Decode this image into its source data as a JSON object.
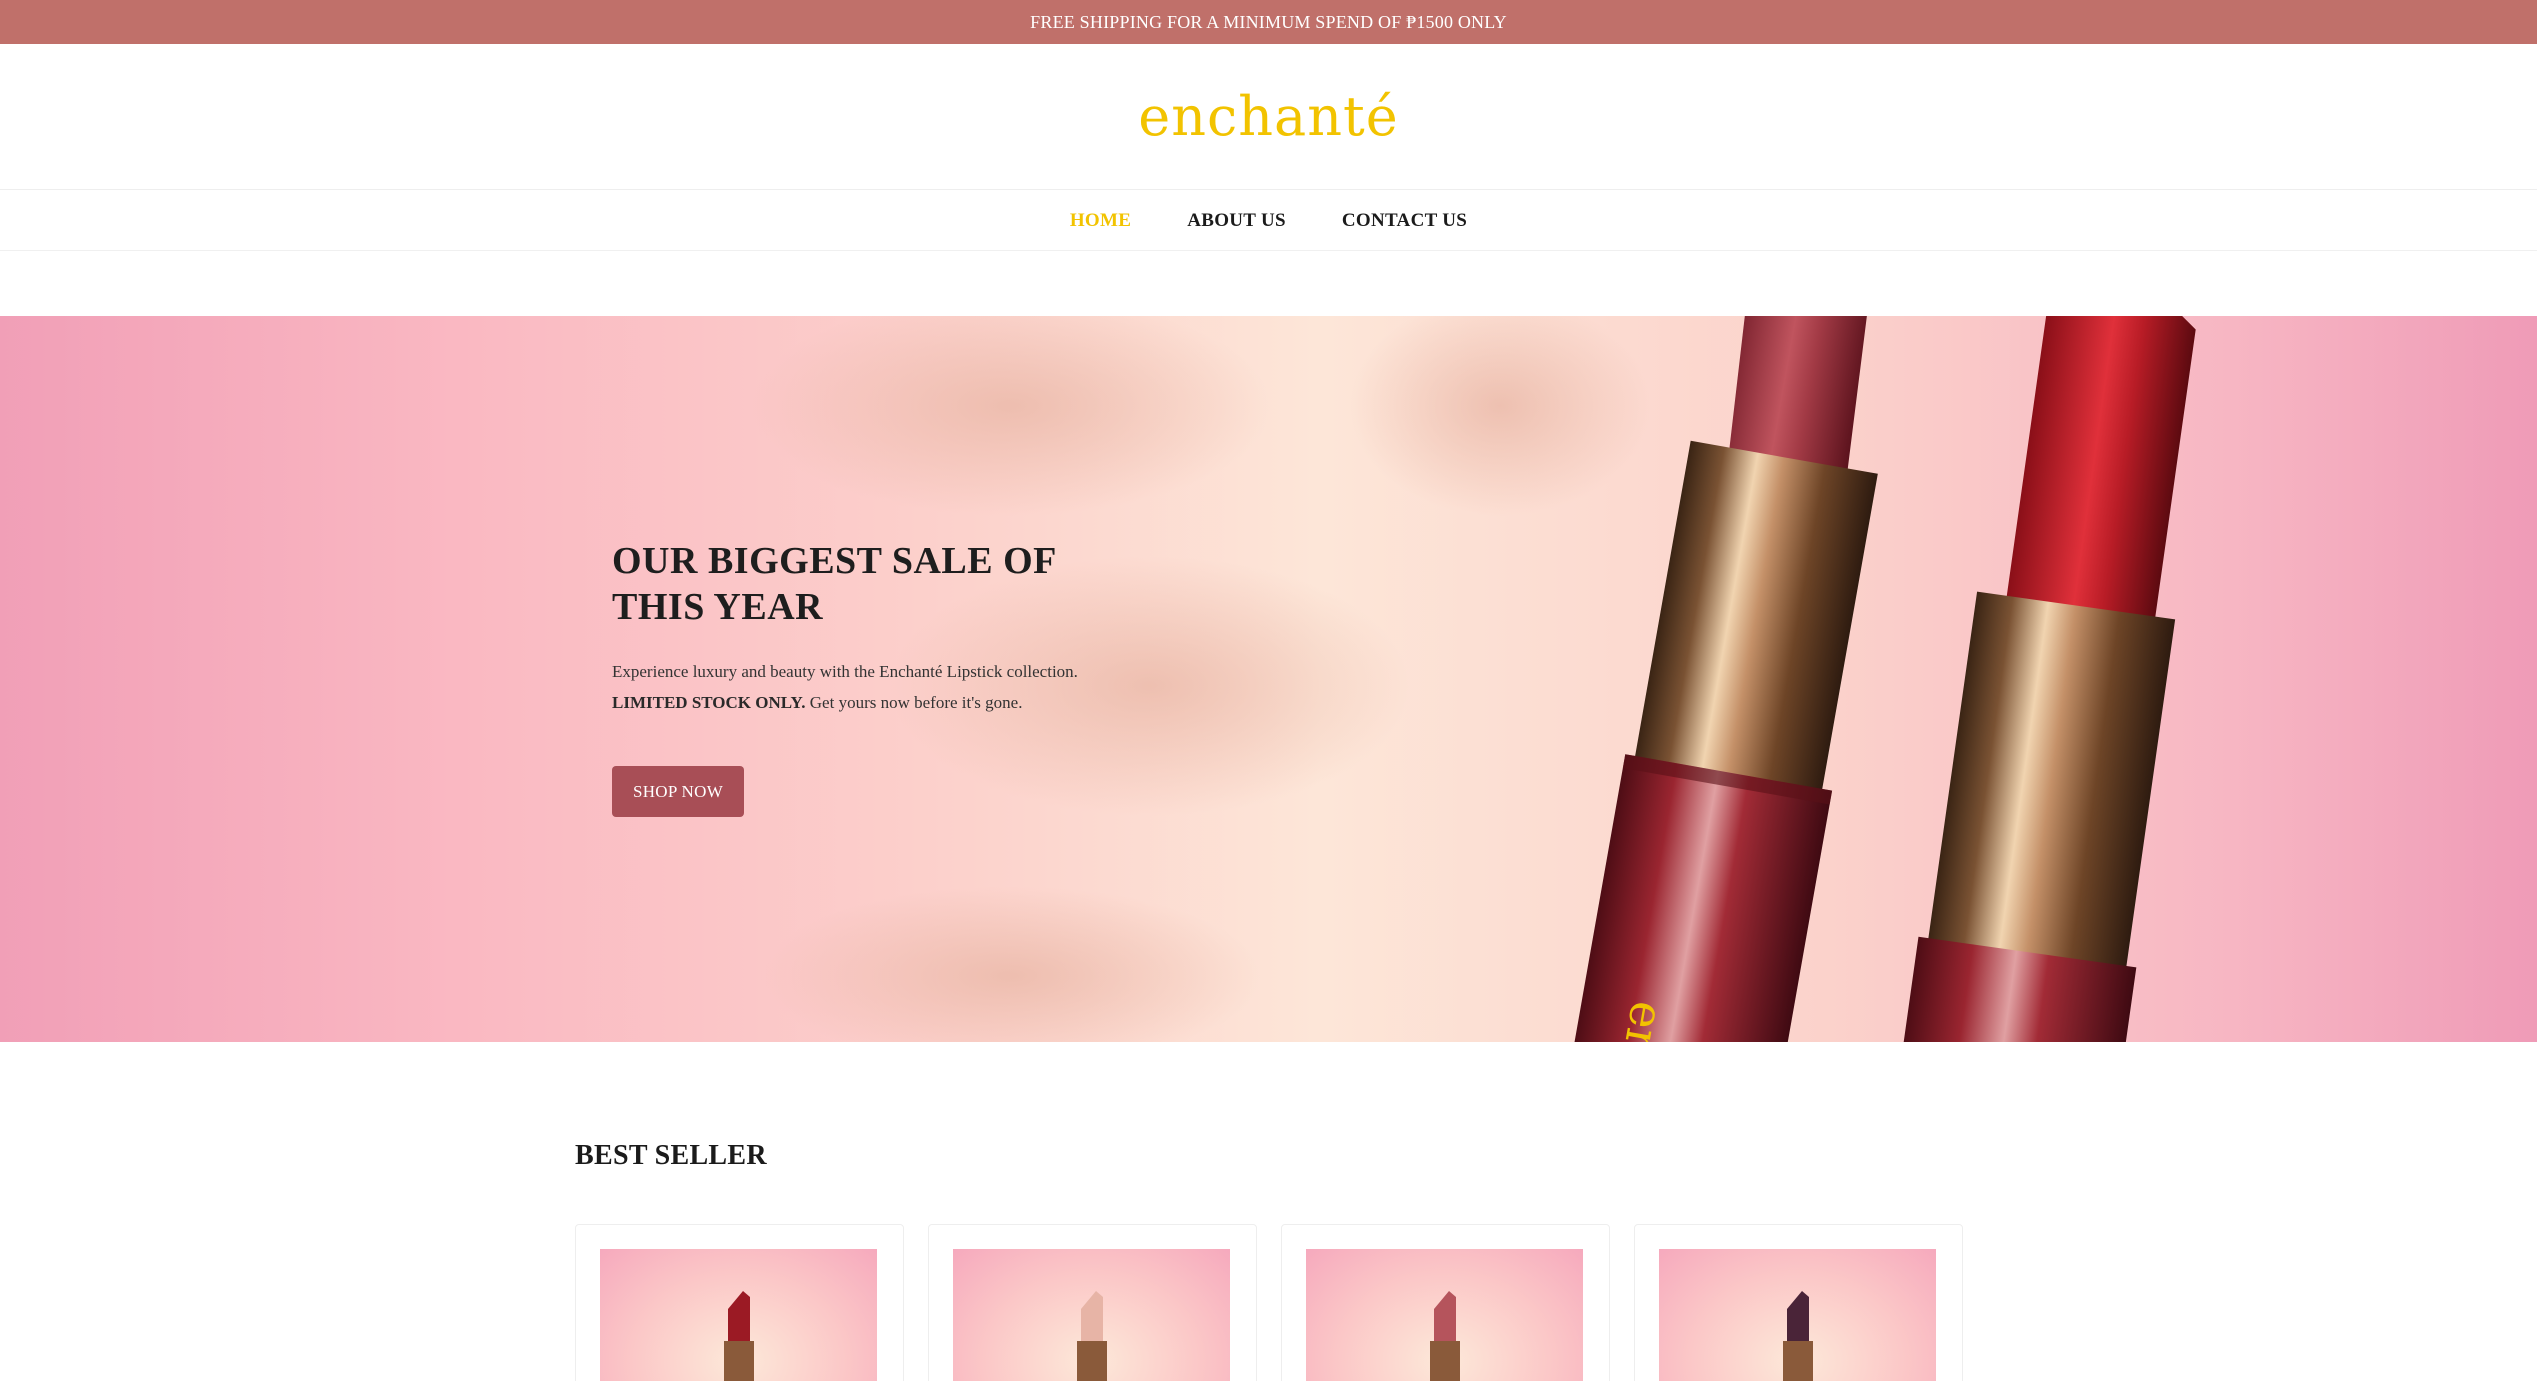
{
  "announcement": "FREE SHIPPING FOR A MINIMUM SPEND OF ₱1500 ONLY",
  "brand": {
    "logo": "enchanté",
    "accent": "#f2c300"
  },
  "colors": {
    "topbar": "#c0706a",
    "button": "#a84e56"
  },
  "nav": {
    "items": [
      {
        "label": "HOME",
        "active": true
      },
      {
        "label": "ABOUT US",
        "active": false
      },
      {
        "label": "CONTACT US",
        "active": false
      }
    ]
  },
  "hero": {
    "title": "OUR BIGGEST SALE OF THIS YEAR",
    "desc_line1": "Experience luxury and beauty with the Enchanté Lipstick collection.",
    "desc_strong": "LIMITED STOCK ONLY.",
    "desc_rest": " Get yours now before it's gone.",
    "button": "SHOP NOW",
    "tube_engraving": "en"
  },
  "best_seller": {
    "title": "BEST SELLER",
    "products": [
      {
        "bullet_color": "#9b1a24"
      },
      {
        "bullet_color": "#e7b4a6"
      },
      {
        "bullet_color": "#b5545c"
      },
      {
        "bullet_color": "#4a2438"
      }
    ]
  }
}
